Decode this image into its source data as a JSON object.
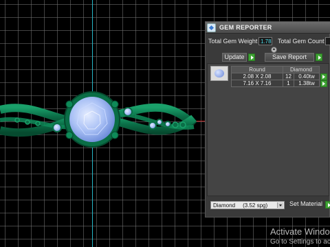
{
  "panel": {
    "title": "GEM REPORTER",
    "total_gem_weight_label": "Total Gem Weight",
    "total_gem_weight_value": "1.78",
    "total_gem_count_label": "Total Gem Count",
    "update_label": "Update",
    "save_report_label": "Save Report",
    "table": {
      "headers": [
        "Round",
        "Diamond"
      ],
      "rows": [
        {
          "size": "2.08 X 2.08",
          "count": "12",
          "weight": "0.40tw"
        },
        {
          "size": "7.16 X 7.16",
          "count": "1",
          "weight": "1.38tw"
        }
      ]
    },
    "material_value": "Diamond     (3.52 spg)",
    "set_material_label": "Set Material"
  },
  "watermark": {
    "title": "Activate Windo",
    "subtitle": "Go to Settings to activ"
  },
  "colors": {
    "ring_green": "#0c7a4f",
    "grid": "#7a7a7a",
    "axis_cyan": "#26b8c8",
    "gem_blue": "#8fb0f4",
    "go_green": "#3fa334"
  },
  "icons": [
    "gem-reporter-app-icon",
    "play-arrow-icon",
    "dropdown-caret-icon",
    "collapse-arrow-icon"
  ]
}
